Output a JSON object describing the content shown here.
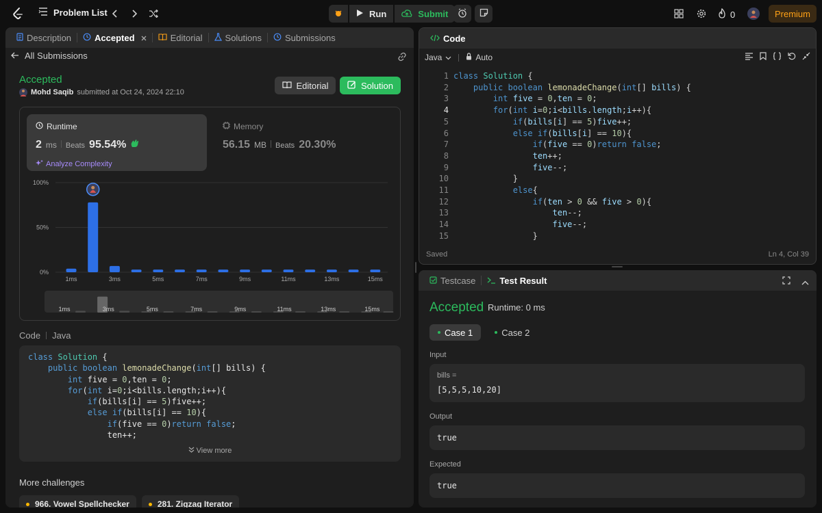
{
  "topbar": {
    "problem_list": "Problem List",
    "run": "Run",
    "submit": "Submit",
    "streak": "0",
    "premium": "Premium"
  },
  "left_tabs": [
    {
      "label": "Description",
      "icon": "document-icon"
    },
    {
      "label": "Accepted",
      "icon": "history-icon"
    },
    {
      "label": "Editorial",
      "icon": "book-icon"
    },
    {
      "label": "Solutions",
      "icon": "flask-icon"
    },
    {
      "label": "Submissions",
      "icon": "history-icon"
    }
  ],
  "submission": {
    "back_label": "All Submissions",
    "status": "Accepted",
    "user": "Mohd Saqib",
    "submitted_text": "submitted at Oct 24, 2024 22:10",
    "editorial_btn": "Editorial",
    "solution_btn": "Solution"
  },
  "runtime": {
    "label": "Runtime",
    "value": "2",
    "unit": "ms",
    "beats_label": "Beats",
    "beats": "95.54%",
    "analyze": "Analyze Complexity"
  },
  "memory": {
    "label": "Memory",
    "value": "56.15",
    "unit": "MB",
    "beats_label": "Beats",
    "beats": "20.30%"
  },
  "chart_data": {
    "type": "bar",
    "categories": [
      "1ms",
      "2ms",
      "3ms",
      "4ms",
      "5ms",
      "6ms",
      "7ms",
      "8ms",
      "9ms",
      "10ms",
      "11ms",
      "12ms",
      "13ms",
      "14ms",
      "15ms"
    ],
    "tick_labels": [
      "1ms",
      "3ms",
      "5ms",
      "7ms",
      "9ms",
      "11ms",
      "13ms",
      "15ms"
    ],
    "values": [
      4,
      78,
      7,
      3,
      3,
      3,
      3,
      3,
      3,
      3,
      3,
      3,
      3,
      3,
      3
    ],
    "ylim": [
      0,
      100
    ],
    "ytick_labels": [
      "100%",
      "50%",
      "0%"
    ],
    "highlight_index": 1,
    "accent": "#2d6fe6",
    "mini_values": [
      2,
      18,
      2,
      1,
      1,
      1,
      1,
      1,
      1,
      1,
      1,
      1,
      1,
      1,
      1
    ]
  },
  "code_section": {
    "label": "Code",
    "lang": "Java",
    "view_more": "View more"
  },
  "more_challenges": {
    "title": "More challenges",
    "items": [
      "966. Vowel Spellchecker",
      "281. Zigzag Iterator"
    ]
  },
  "editor": {
    "title": "Code",
    "language": "Java",
    "mode": "Auto",
    "saved": "Saved",
    "cursor": "Ln 4, Col 39",
    "line_numbers": [
      "1",
      "2",
      "3",
      "4",
      "5",
      "6",
      "7",
      "8",
      "9",
      "10",
      "11",
      "12",
      "13",
      "14",
      "15"
    ],
    "current_line": 4
  },
  "testpanel": {
    "testcase_tab": "Testcase",
    "result_tab": "Test Result",
    "status": "Accepted",
    "runtime": "Runtime: 0 ms",
    "cases": [
      "Case 1",
      "Case 2"
    ],
    "input_label": "Input",
    "input_var": "bills =",
    "input_value": "[5,5,5,10,20]",
    "output_label": "Output",
    "output_value": "true",
    "expected_label": "Expected",
    "expected_value": "true"
  },
  "colors": {
    "accent_green": "#2cbb5d",
    "premium": "#ffa116",
    "bar_blue": "#2d6fe6"
  }
}
